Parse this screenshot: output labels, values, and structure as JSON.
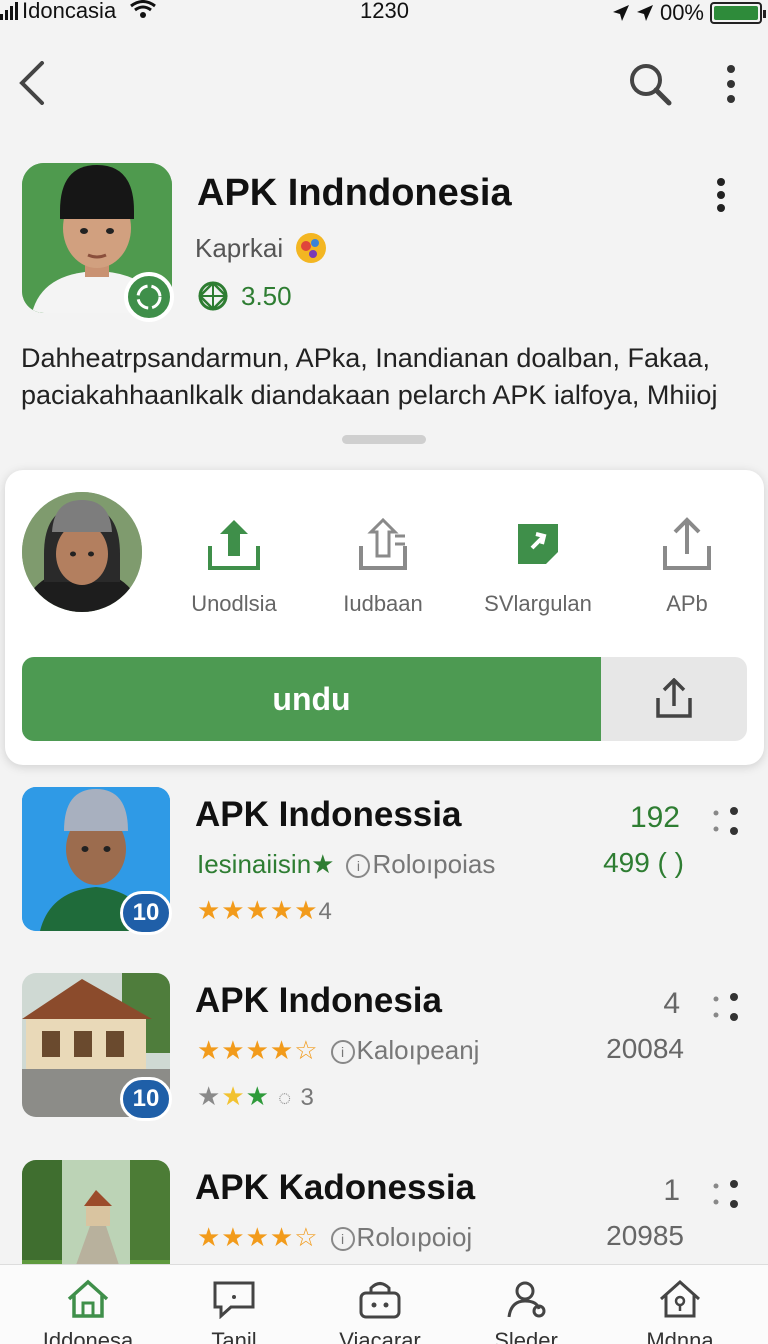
{
  "status_bar": {
    "carrier": "Idoncasia",
    "time": "1230",
    "battery": "00%"
  },
  "app": {
    "title": "APK Indndonesia",
    "developer": "Kaprkai",
    "rating": "3.50",
    "description": "Dahheatrpsandarmun, APka, Inandianan doalban, Fakaa, paciakahhaanlkalk diandakaan pelarch APK ialfoya, Mhiioj"
  },
  "actions": [
    {
      "label": "Unodlsia",
      "icon": "upload-icon"
    },
    {
      "label": "Iudbaan",
      "icon": "file-upload-icon"
    },
    {
      "label": "SVlargulan",
      "icon": "tag-icon"
    },
    {
      "label": "APb",
      "icon": "share-icon"
    }
  ],
  "download_button": {
    "label": "undu"
  },
  "list": [
    {
      "title": "APK Indonessia",
      "tag": "Iesinaiisin",
      "dev": "Roloıpoias",
      "rating_count": "4",
      "num1": "192",
      "num2": "499 ( )",
      "badge": "10"
    },
    {
      "title": "APK Indonesia",
      "dev": "Kaloıpeanj",
      "rating_count": "3",
      "num1": "4",
      "num2": "20084",
      "badge": "10"
    },
    {
      "title": "APK Kadonessia",
      "dev": "Roloıpoioj",
      "num1": "1",
      "num2": "20985"
    }
  ],
  "bottom_nav": [
    {
      "label": "Iddonesa",
      "icon": "home-icon",
      "active": true
    },
    {
      "label": "Tanil",
      "icon": "chat-icon"
    },
    {
      "label": "Viacarar",
      "icon": "bag-icon"
    },
    {
      "label": "Sleder",
      "icon": "people-icon"
    },
    {
      "label": "Mdnna",
      "icon": "house-lock-icon"
    }
  ],
  "colors": {
    "accent": "#4d9a52",
    "star": "#f29b1b",
    "badge": "#1f5fa8"
  }
}
